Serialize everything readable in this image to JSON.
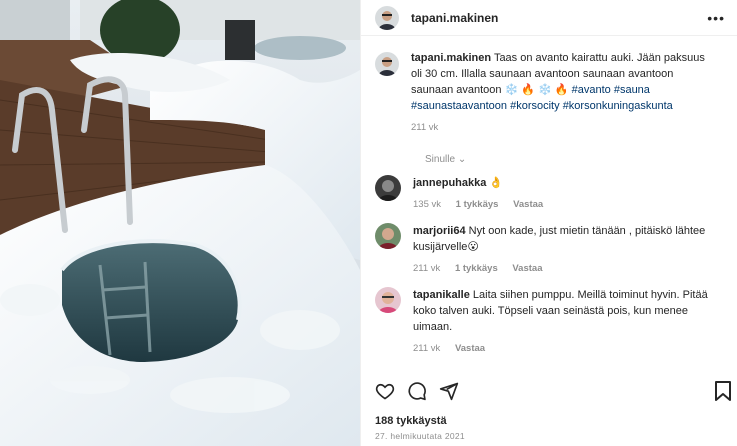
{
  "post": {
    "author": "tapani.makinen",
    "caption_author": "tapani.makinen",
    "caption_text": "Taas on avanto kairattu auki. Jään paksuus oli 30 cm. Illalla saunaan avantoon saunaan avantoon saunaan avantoon ❄️ 🔥 ❄️ 🔥",
    "hashtags": [
      "#avanto",
      "#sauna",
      "#saunastaavantoon",
      "#korsocity",
      "#korsonkuningaskunta"
    ],
    "caption_time": "211 vk",
    "translate_label": "Sinulle",
    "likes": "188 tykkäystä",
    "date": "27. helmikuutata 2021"
  },
  "comments": [
    {
      "user": "jannepuhakka",
      "text": "👌",
      "time": "135 vk",
      "likes": "1 tykkäys",
      "reply": "Vastaa"
    },
    {
      "user": "marjorii64",
      "text": "Nyt oon kade, just mietin tänään , pitäiskö lähtee kusijärvelle😮",
      "time": "211 vk",
      "likes": "1 tykkäys",
      "reply": "Vastaa"
    },
    {
      "user": "tapanikalle",
      "text": "Laita siihen pumppu. Meillä toiminut hyvin. Pitää koko talven auki. Töpseli vaan seinästä pois, kun menee uimaan.",
      "time": "211 vk",
      "likes": "",
      "reply": "Vastaa"
    }
  ],
  "icons": {
    "more": "more-options-icon",
    "like": "heart-icon",
    "comment": "comment-icon",
    "share": "share-icon",
    "save": "bookmark-icon"
  }
}
